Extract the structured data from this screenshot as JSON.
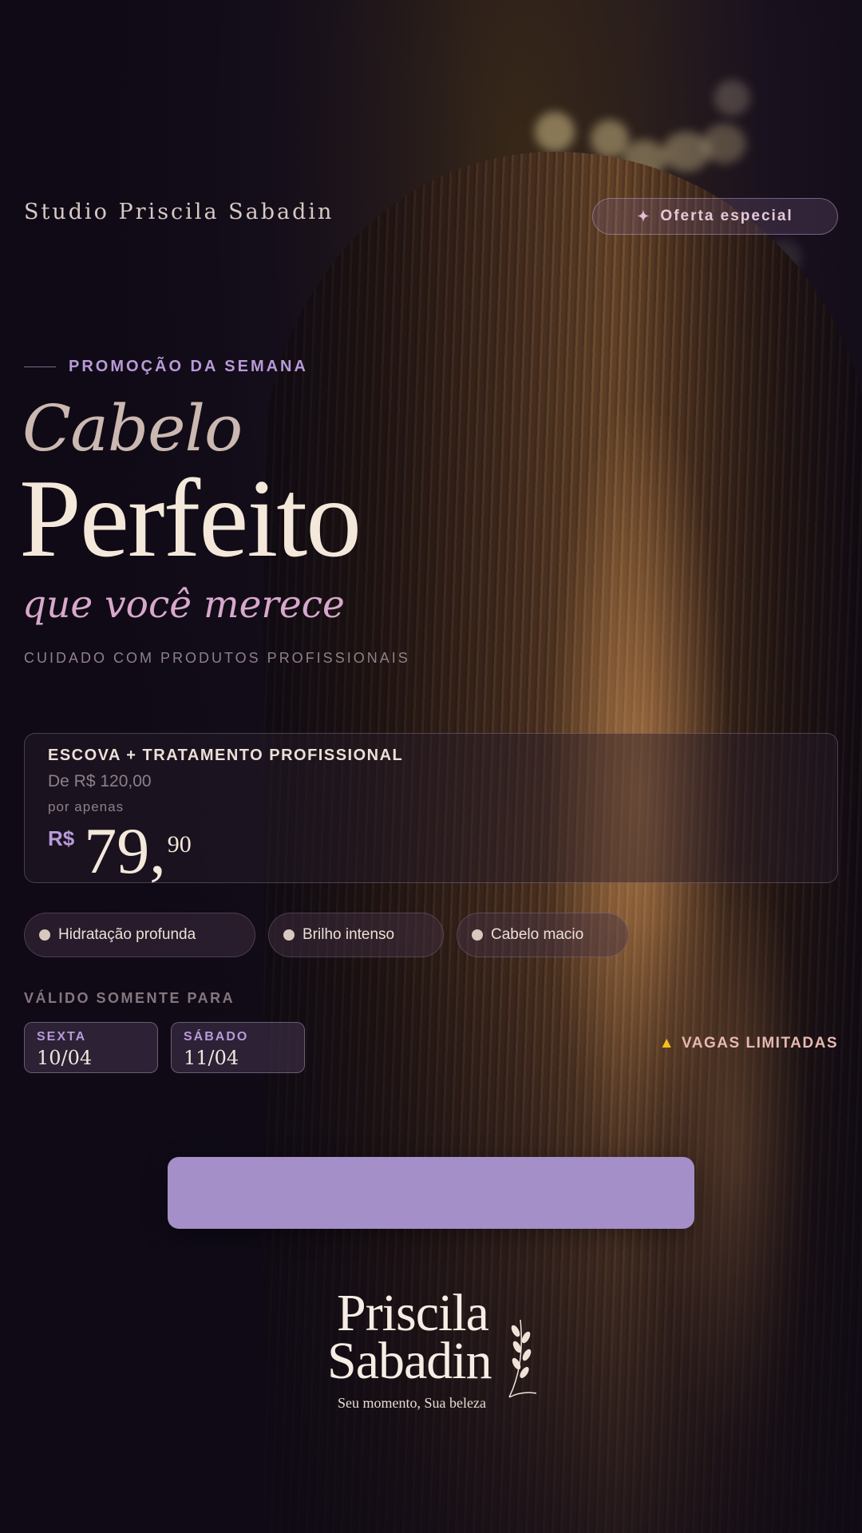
{
  "header": {
    "studio_name": "Studio Priscila Sabadin",
    "offer_badge": "Oferta especial",
    "offer_icon": "sparkle-icon"
  },
  "hero": {
    "promo_label": "PROMOÇÃO DA SEMANA",
    "title_line1": "Cabelo",
    "title_line2": "Perfeito",
    "title_line3": "que você merece",
    "subtitle": "CUIDADO COM PRODUTOS PROFISSIONAIS"
  },
  "offer": {
    "service": "ESCOVA + TRATAMENTO PROFISSIONAL",
    "old_price": "De R$ 120,00",
    "por_apenas": "por apenas",
    "currency": "R$",
    "price_int": "79,",
    "price_dec": "90"
  },
  "benefits": [
    "Hidratação profunda",
    "Brilho intenso",
    "Cabelo macio"
  ],
  "validity": {
    "label": "VÁLIDO SOMENTE PARA",
    "dates": [
      {
        "day": "SEXTA",
        "date": "10/04"
      },
      {
        "day": "SÁBADO",
        "date": "11/04"
      }
    ],
    "limited": "VAGAS LIMITADAS",
    "limited_icon": "warning-icon"
  },
  "cta": {
    "label": ""
  },
  "logo": {
    "line1": "Priscila",
    "line2": "Sabadin",
    "tagline": "Seu momento, Sua beleza"
  },
  "colors": {
    "accent_lavender": "#a48fc8",
    "accent_pink": "#d8a8cc",
    "cream": "#f4e8da",
    "background": "#0f0a16"
  }
}
